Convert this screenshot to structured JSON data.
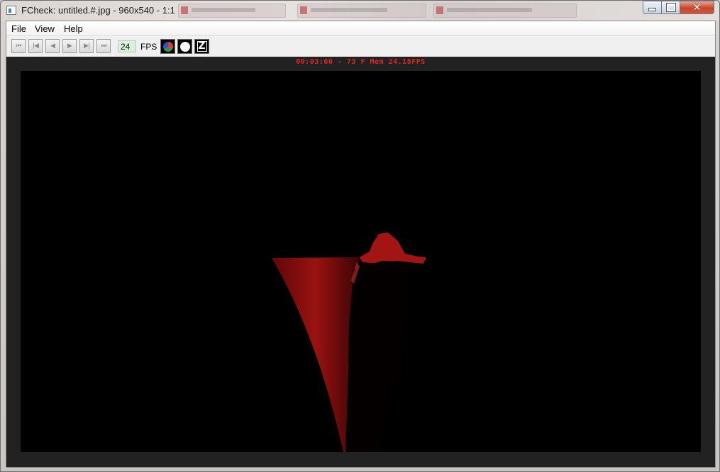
{
  "window": {
    "title": "FCheck: untitled.#.jpg - 960x540 - 1:1",
    "close_glyph": "✕"
  },
  "menubar": {
    "items": [
      "File",
      "View",
      "Help"
    ]
  },
  "toolbar": {
    "buttons": [
      {
        "name": "first-frame",
        "glyph": "⏮"
      },
      {
        "name": "step-back",
        "glyph": "|◀"
      },
      {
        "name": "play-reverse",
        "glyph": "◀"
      },
      {
        "name": "play-forward",
        "glyph": "▶"
      },
      {
        "name": "step-forward",
        "glyph": "▶|"
      },
      {
        "name": "last-frame",
        "glyph": "⏭"
      }
    ],
    "fps_value": "24",
    "fps_label": "FPS",
    "icons": [
      "rgb-channels-icon",
      "alpha-channel-icon",
      "z-depth-icon"
    ],
    "z_label": "Z"
  },
  "viewer": {
    "status": "00:03:00 - 73 F Mem 24.18FPS",
    "status_color": "#e3261e",
    "frame_background": "#000000",
    "subject_color": "#8e1010"
  }
}
